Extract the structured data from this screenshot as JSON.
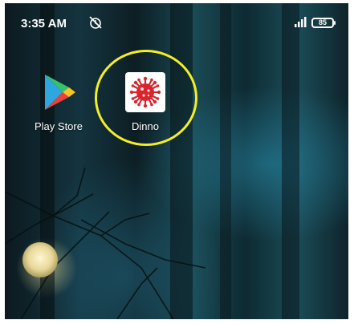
{
  "status_bar": {
    "time": "3:35 AM",
    "battery_level": "85",
    "alarm_icon": "alarm-off-icon",
    "signal_icon": "signal-icon"
  },
  "apps": [
    {
      "label": "Play Store",
      "icon": "play-store-icon"
    },
    {
      "label": "Dinno",
      "icon": "virus-icon"
    }
  ],
  "colors": {
    "highlight_ring": "#f2ee2a",
    "dinno_icon_red": "#d8262e",
    "wallpaper_teal": "#1a4a55"
  }
}
